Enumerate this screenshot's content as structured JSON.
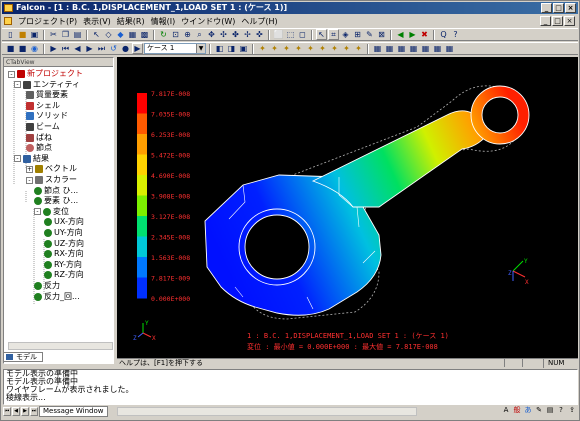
{
  "window": {
    "title": "Falcon - [1 : B.C. 1,DISPLACEMENT_1,LOAD SET 1 : (ケース 1)]",
    "minimize": "_",
    "maximize": "□",
    "close": "×"
  },
  "menu": {
    "items": [
      "プロジェクト(P)",
      "表示(V)",
      "結果(R)",
      "情報(I)",
      "ウインドウ(W)",
      "ヘルプ(H)"
    ],
    "mdi_buttons": [
      "_",
      "□",
      "×"
    ]
  },
  "toolbar": {
    "case_combo": "ケース 1"
  },
  "tree_panel": {
    "header": "CTabView",
    "tab_label": "モデル",
    "nodes": [
      {
        "label": "新プロジェクト",
        "depth": 0,
        "icon": "project-icon",
        "color": "#c00000"
      },
      {
        "label": "エンティティ",
        "depth": 1,
        "icon": "entity-icon",
        "color": "#000000"
      },
      {
        "label": "質量要素",
        "depth": 2,
        "icon": "mass-icon",
        "color": "#000000"
      },
      {
        "label": "シェル",
        "depth": 2,
        "icon": "shell-icon",
        "color": "#000000"
      },
      {
        "label": "ソリッド",
        "depth": 2,
        "icon": "solid-icon",
        "color": "#000000"
      },
      {
        "label": "ビーム",
        "depth": 2,
        "icon": "beam-icon",
        "color": "#000000"
      },
      {
        "label": "ばね",
        "depth": 2,
        "icon": "spring-icon",
        "color": "#000000"
      },
      {
        "label": "節点",
        "depth": 2,
        "icon": "node-icon",
        "color": "#000000"
      },
      {
        "label": "結果",
        "depth": 1,
        "icon": "results-icon",
        "color": "#000000"
      },
      {
        "label": "ベクトル",
        "depth": 2,
        "icon": "vector-icon",
        "color": "#000000"
      },
      {
        "label": "スカラー",
        "depth": 2,
        "icon": "scalar-icon",
        "color": "#000000"
      },
      {
        "label": "節点 ひ...",
        "depth": 3,
        "icon": "scalar-item-icon",
        "color": "#000000"
      },
      {
        "label": "要素 ひ...",
        "depth": 3,
        "icon": "scalar-item-icon",
        "color": "#000000"
      },
      {
        "label": "変位",
        "depth": 3,
        "icon": "scalar-item-icon",
        "color": "#000000"
      },
      {
        "label": "UX-方向",
        "depth": 4,
        "icon": "scalar-item-icon",
        "color": "#000000"
      },
      {
        "label": "UY-方向",
        "depth": 4,
        "icon": "scalar-item-icon",
        "color": "#000000"
      },
      {
        "label": "UZ-方向",
        "depth": 4,
        "icon": "scalar-item-icon",
        "color": "#000000"
      },
      {
        "label": "RX-方向",
        "depth": 4,
        "icon": "scalar-item-icon",
        "color": "#000000"
      },
      {
        "label": "RY-方向",
        "depth": 4,
        "icon": "scalar-item-icon",
        "color": "#000000"
      },
      {
        "label": "RZ-方向",
        "depth": 4,
        "icon": "scalar-item-icon",
        "color": "#000000"
      },
      {
        "label": "反力",
        "depth": 3,
        "icon": "scalar-item-icon",
        "color": "#000000"
      },
      {
        "label": "反力_回...",
        "depth": 3,
        "icon": "scalar-item-icon",
        "color": "#000000"
      }
    ]
  },
  "viewport": {
    "legend_labels": [
      "7.817E-008",
      "7.035E-008",
      "6.253E-008",
      "5.472E-008",
      "4.690E-008",
      "3.908E-008",
      "3.127E-008",
      "2.345E-008",
      "1.563E-008",
      "7.817E-009",
      "0.000E+000"
    ],
    "legend_colors": [
      "#ff0000",
      "#ff5a00",
      "#ff9e00",
      "#ffd200",
      "#d8f000",
      "#7cf000",
      "#00e070",
      "#00c8d8",
      "#0078ff",
      "#0030ff",
      "#0000e0"
    ],
    "caption_line1": "1 : B.C. 1,DISPLACEMENT_1,LOAD SET 1  :  (ケース 1)",
    "caption_line2": "変位 : 最小値 = 0.000E+000 : 最大値 = 7.817E-008",
    "axis_labels": {
      "x": "X",
      "y": "Y",
      "z": "Z"
    }
  },
  "statusbar": {
    "help_text": "ヘルプは、[F1]を押下する",
    "num_indicator": "NUM"
  },
  "message_window": {
    "lines": [
      "モデル表示の準備中",
      "モデル表示の準備中",
      "ワイヤフレームが表示されました。",
      "稜線表示..."
    ],
    "tab_label": "Message Window"
  }
}
